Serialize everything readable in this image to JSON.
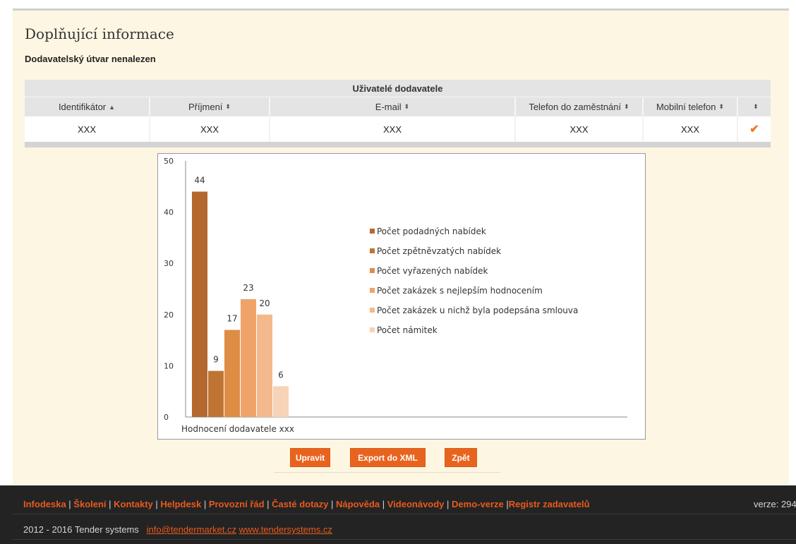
{
  "page": {
    "title": "Doplňující informace",
    "subtitle": "Dodavatelský útvar nenalezen"
  },
  "grid": {
    "caption": "Uživatelé dodavatele",
    "columns": [
      {
        "label": "Identifikátor",
        "sort_icon": "▲"
      },
      {
        "label": "Příjmení",
        "sort_icon": "⬍"
      },
      {
        "label": "E-mail",
        "sort_icon": "⬍"
      },
      {
        "label": "Telefon do zaměstnání",
        "sort_icon": "⬍"
      },
      {
        "label": "Mobilní telefon",
        "sort_icon": "⬍"
      },
      {
        "label": "",
        "sort_icon": "⬍"
      }
    ],
    "rows": [
      {
        "identifikator": "XXX",
        "prijmeni": "XXX",
        "email": "XXX",
        "telefon": "XXX",
        "mobil": "XXX",
        "status_icon": "check-icon"
      }
    ]
  },
  "chart_data": {
    "type": "bar",
    "categories": [
      "Hodnocení dodavatele xxx"
    ],
    "series": [
      {
        "name": "Počet podadných nabídek",
        "values": [
          44
        ],
        "color": "#b5682e"
      },
      {
        "name": "Počet zpětněvzatých nabídek",
        "values": [
          9
        ],
        "color": "#c07434"
      },
      {
        "name": "Počet vyřazených nabídek",
        "values": [
          17
        ],
        "color": "#de8d45"
      },
      {
        "name": "Počet zakázek s nejlepším hodnocením",
        "values": [
          23
        ],
        "color": "#f0a369"
      },
      {
        "name": "Počet zakázek u nichž byla podepsána smlouva",
        "values": [
          20
        ],
        "color": "#f3b98c"
      },
      {
        "name": "Počet námitek",
        "values": [
          6
        ],
        "color": "#f7d3b8"
      }
    ],
    "ylim": [
      0,
      50
    ],
    "yticks": [
      0,
      10,
      20,
      30,
      40,
      50
    ],
    "legend": "right",
    "grid": false
  },
  "buttons": {
    "edit": "Upravit",
    "export": "Export do XML",
    "back": "Zpět"
  },
  "footer": {
    "links": [
      "Infodeska",
      "Školení",
      "Kontakty",
      "Helpdesk",
      "Provozní řád",
      "Časté dotazy",
      "Nápověda",
      "Videonávody",
      "Demo-verze",
      "Registr zadavatelů"
    ],
    "version": "verze: 294",
    "copyright": "2012 - 2016 Tender systems",
    "email": "info@tendermarket.cz",
    "website": "www.tendersystems.cz"
  }
}
